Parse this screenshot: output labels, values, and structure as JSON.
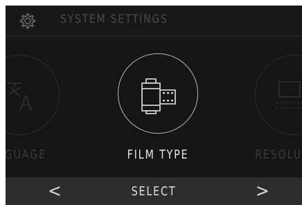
{
  "header": {
    "title": "SYSTEM SETTINGS",
    "icon": "gear-icon"
  },
  "carousel": {
    "items": [
      {
        "label": "NGUAGE",
        "icon": "language-icon",
        "state": "dimmed"
      },
      {
        "label": "FILM TYPE",
        "icon": "film-canister-icon",
        "state": "selected"
      },
      {
        "label": "RESOLU",
        "icon": "resolution-icon",
        "state": "dimmed"
      }
    ]
  },
  "footer": {
    "prev_label": "<",
    "select_label": "SELECT",
    "next_label": ">"
  },
  "colors": {
    "background": "#151515",
    "header_bg": "#181818",
    "footer_bg": "#2d2d2d",
    "active_text": "#e6e6e6",
    "dimmed_text": "#3a3a3a"
  }
}
